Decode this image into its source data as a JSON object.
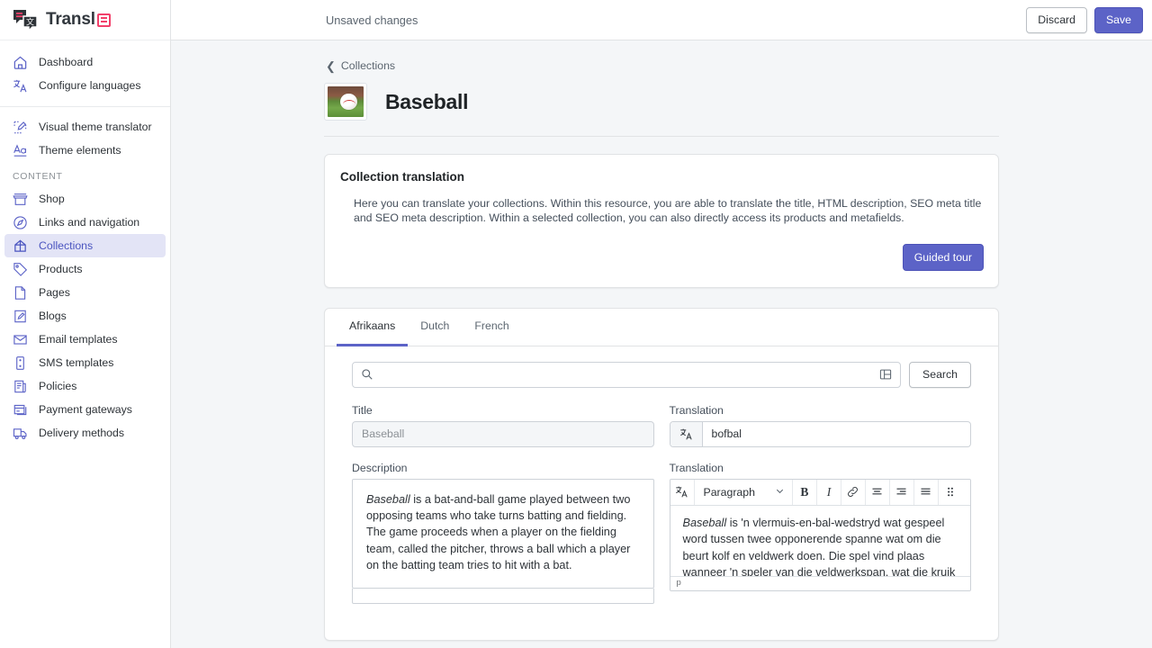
{
  "brand": {
    "name": "Transl",
    "badge_icon": "list-badge-icon"
  },
  "sidebar": {
    "primary": [
      {
        "label": "Dashboard",
        "icon": "home-icon"
      },
      {
        "label": "Configure languages",
        "icon": "translate-icon"
      }
    ],
    "secondary": [
      {
        "label": "Visual theme translator",
        "icon": "theme-edit-icon"
      },
      {
        "label": "Theme elements",
        "icon": "font-icon"
      }
    ],
    "content_heading": "CONTENT",
    "content": [
      {
        "label": "Shop",
        "icon": "store-icon",
        "active": false
      },
      {
        "label": "Links and navigation",
        "icon": "compass-icon",
        "active": false
      },
      {
        "label": "Collections",
        "icon": "collection-icon",
        "active": true
      },
      {
        "label": "Products",
        "icon": "tag-icon",
        "active": false
      },
      {
        "label": "Pages",
        "icon": "page-icon",
        "active": false
      },
      {
        "label": "Blogs",
        "icon": "blog-edit-icon",
        "active": false
      },
      {
        "label": "Email templates",
        "icon": "envelope-icon",
        "active": false
      },
      {
        "label": "SMS templates",
        "icon": "phone-icon",
        "active": false
      },
      {
        "label": "Policies",
        "icon": "scroll-icon",
        "active": false
      },
      {
        "label": "Payment gateways",
        "icon": "payment-icon",
        "active": false
      },
      {
        "label": "Delivery methods",
        "icon": "truck-icon",
        "active": false
      }
    ]
  },
  "topbar": {
    "status": "Unsaved changes",
    "discard_label": "Discard",
    "save_label": "Save"
  },
  "breadcrumb": {
    "label": "Collections",
    "icon": "chevron-left-icon"
  },
  "header": {
    "title": "Baseball",
    "thumb_alt": "baseball-thumbnail"
  },
  "info_card": {
    "title": "Collection translation",
    "description": "Here you can translate your collections. Within this resource, you are able to translate the title, HTML description, SEO meta title and SEO meta description. Within a selected collection, you can also directly access its products and metafields.",
    "tour_label": "Guided tour"
  },
  "tabs": [
    {
      "label": "Afrikaans",
      "active": true
    },
    {
      "label": "Dutch",
      "active": false
    },
    {
      "label": "French",
      "active": false
    }
  ],
  "search": {
    "value": "",
    "placeholder": "",
    "icon": "search-icon",
    "panel_icon": "layout-panel-icon",
    "button_label": "Search"
  },
  "title_field": {
    "label": "Title",
    "value": "Baseball",
    "translation_label": "Translation",
    "translation_value": "bofbal",
    "translation_prefix_icon": "translate-icon"
  },
  "description_field": {
    "label": "Description",
    "source_emphasis": "Baseball",
    "source_rest": " is a bat-and-ball game played between two opposing teams who take turns batting and fielding. The game proceeds when a player on the fielding team, called the pitcher, throws a ball which a player on the batting team tries to hit with a bat.",
    "translation_label": "Translation",
    "translation_emphasis": "Baseball",
    "translation_rest": " is 'n vlermuis-en-bal-wedstryd wat gespeel word tussen twee opponerende spanne wat om die beurt kolf en veldwerk doen. Die spel vind plaas wanneer 'n speler van die veldwerkspan, wat die kruik genoem word, 'n bal gooi wat 'n speler in die kolfspan",
    "status": "p"
  },
  "editor_toolbar": {
    "translate_icon": "translate-icon",
    "block_format": "Paragraph",
    "chevron_icon": "chevron-down-icon",
    "bold_label": "B",
    "italic_label": "I",
    "link_icon": "link-icon",
    "align_center_icon": "align-center-icon",
    "align_right_icon": "align-right-icon",
    "align_justify_icon": "align-justify-icon",
    "drag_icon": "drag-handle-icon"
  },
  "colors": {
    "accent": "#5C63C7",
    "accent_soft": "#E3E4F6",
    "brand_pink": "#F2406A",
    "page_bg": "#F4F6F8",
    "border": "#E1E3E5"
  }
}
